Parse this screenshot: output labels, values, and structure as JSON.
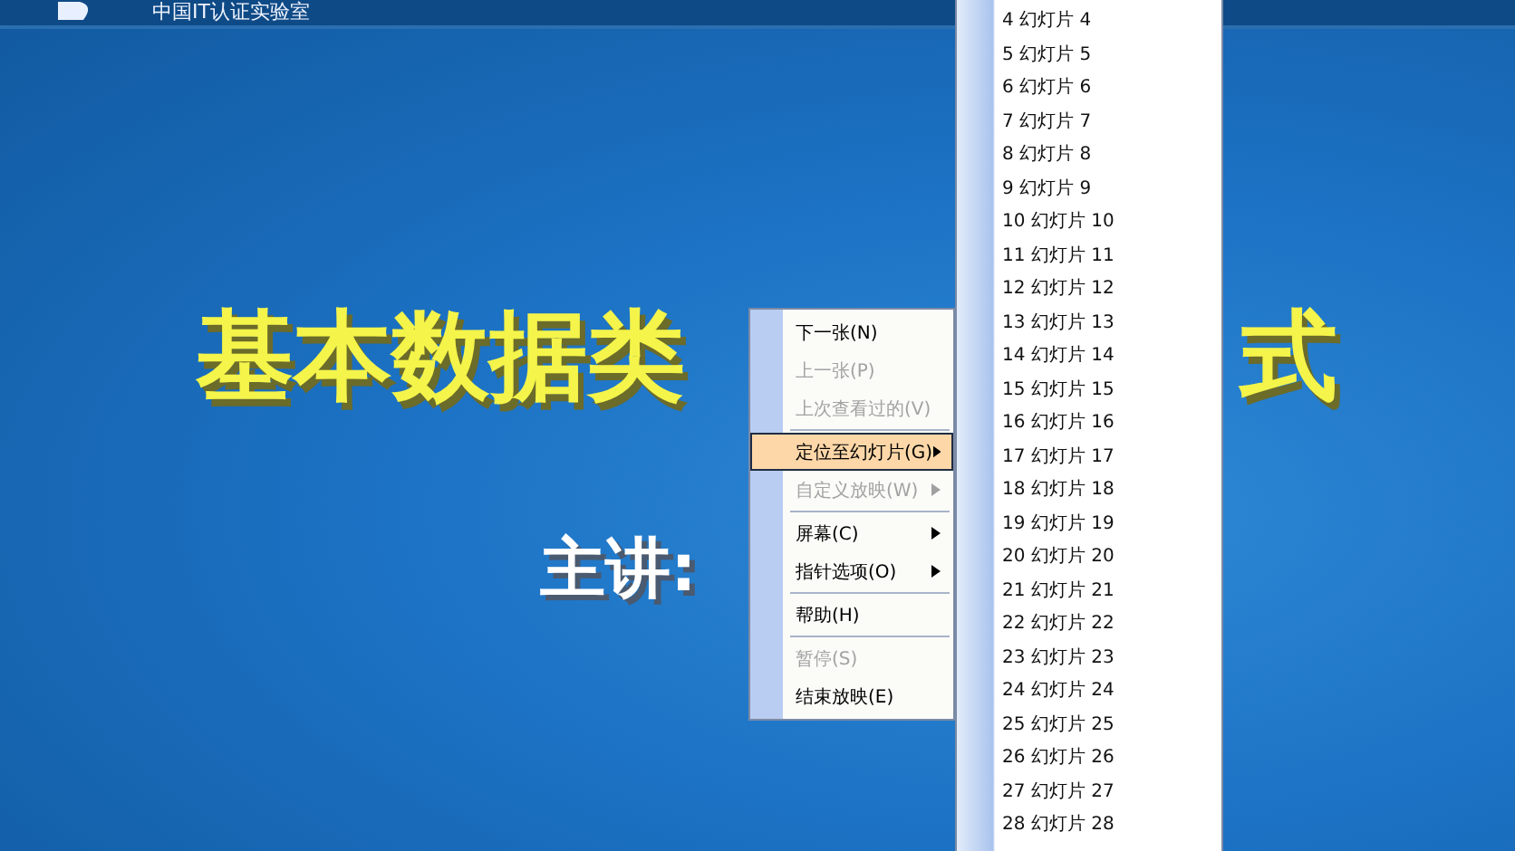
{
  "header": {
    "title": "中国IT认证实验室"
  },
  "slide": {
    "title_parts": [
      "基本数据类",
      "式"
    ],
    "subtitle": "主讲:"
  },
  "context_menu": [
    {
      "kind": "item",
      "label": "下一张(N)",
      "disabled": false,
      "selected": false,
      "submenu": false
    },
    {
      "kind": "item",
      "label": "上一张(P)",
      "disabled": true,
      "selected": false,
      "submenu": false
    },
    {
      "kind": "item",
      "label": "上次查看过的(V)",
      "disabled": true,
      "selected": false,
      "submenu": false
    },
    {
      "kind": "separator"
    },
    {
      "kind": "item",
      "label": "定位至幻灯片(G)",
      "disabled": false,
      "selected": true,
      "submenu": true
    },
    {
      "kind": "item",
      "label": "自定义放映(W)",
      "disabled": true,
      "selected": false,
      "submenu": true
    },
    {
      "kind": "separator"
    },
    {
      "kind": "item",
      "label": "屏幕(C)",
      "disabled": false,
      "selected": false,
      "submenu": true
    },
    {
      "kind": "item",
      "label": "指针选项(O)",
      "disabled": false,
      "selected": false,
      "submenu": true
    },
    {
      "kind": "separator"
    },
    {
      "kind": "item",
      "label": "帮助(H)",
      "disabled": false,
      "selected": false,
      "submenu": false
    },
    {
      "kind": "separator"
    },
    {
      "kind": "item",
      "label": "暂停(S)",
      "disabled": true,
      "selected": false,
      "submenu": false
    },
    {
      "kind": "item",
      "label": "结束放映(E)",
      "disabled": false,
      "selected": false,
      "submenu": false
    }
  ],
  "slide_submenu": [
    "4 幻灯片 4",
    "5 幻灯片 5",
    "6 幻灯片 6",
    "7 幻灯片 7",
    "8 幻灯片 8",
    "9 幻灯片 9",
    "10 幻灯片 10",
    "11 幻灯片 11",
    "12 幻灯片 12",
    "13 幻灯片 13",
    "14 幻灯片 14",
    "15 幻灯片 15",
    "16 幻灯片 16",
    "17 幻灯片 17",
    "18 幻灯片 18",
    "19 幻灯片 19",
    "20 幻灯片 20",
    "21 幻灯片 21",
    "22 幻灯片 22",
    "23 幻灯片 23",
    "24 幻灯片 24",
    "25 幻灯片 25",
    "26 幻灯片 26",
    "27 幻灯片 27",
    "28 幻灯片 28"
  ]
}
